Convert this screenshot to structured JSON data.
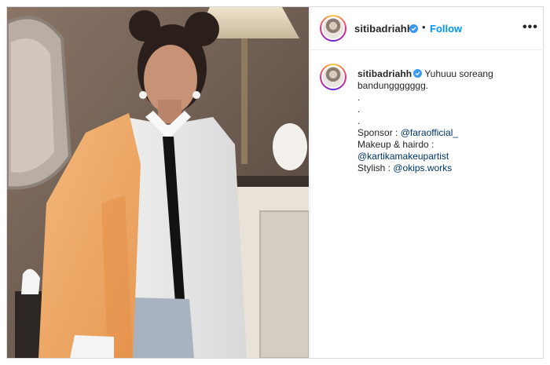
{
  "post": {
    "username": "sitibadriahh",
    "separator": "•",
    "follow_label": "Follow",
    "more_label": "•••",
    "caption": {
      "first_text": "Yuhuuu soreang",
      "second_text": "bandunggggggg.",
      "dot1": ".",
      "dot2": ".",
      "dot3": ".",
      "sponsor_label": "Sponsor : ",
      "sponsor_mention": "@faraofficial_",
      "makeup_label": "Makeup & hairdo :",
      "makeup_mention": "@kartikamakeupartist",
      "stylish_label": "Stylish : ",
      "stylish_mention": "@okips.works"
    }
  },
  "colors": {
    "follow": "#0095f6",
    "verified": "#3897f0",
    "mention": "#00376b",
    "cardigan": "#f0a867"
  },
  "icons": {
    "verified": "verified-badge-icon",
    "more": "more-options-icon"
  }
}
